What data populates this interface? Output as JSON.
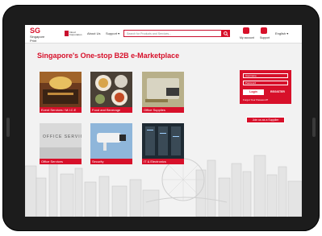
{
  "header": {
    "logo_mark": "SG",
    "logo_sub": "Singapore Print",
    "corp_label": "Cloud Corporation",
    "nav": [
      {
        "label": "About Us"
      },
      {
        "label": "Support ▾"
      }
    ],
    "search_placeholder": "Search for Products and Services...",
    "my_account": "My account",
    "support": "Support",
    "language": "English"
  },
  "main": {
    "title": "Singapore's One-stop B2B e-Marketplace",
    "tiles": [
      {
        "label": "Event Services / M.I.C.E"
      },
      {
        "label": "Food and Beverage"
      },
      {
        "label": "Office Supplies"
      },
      {
        "label": "Office Services"
      },
      {
        "label": "Security"
      },
      {
        "label": "IT & Electronics"
      }
    ]
  },
  "login": {
    "username_placeholder": "Username",
    "password_placeholder": "Password",
    "login_label": "Login",
    "register_label": "REGISTER",
    "forgot_label": "Forgot Your Password?",
    "join_label": "Join us as a Supplier"
  },
  "colors": {
    "accent": "#d7102a",
    "bezel": "#1c1c1c",
    "page_bg": "#f2f2f2"
  }
}
